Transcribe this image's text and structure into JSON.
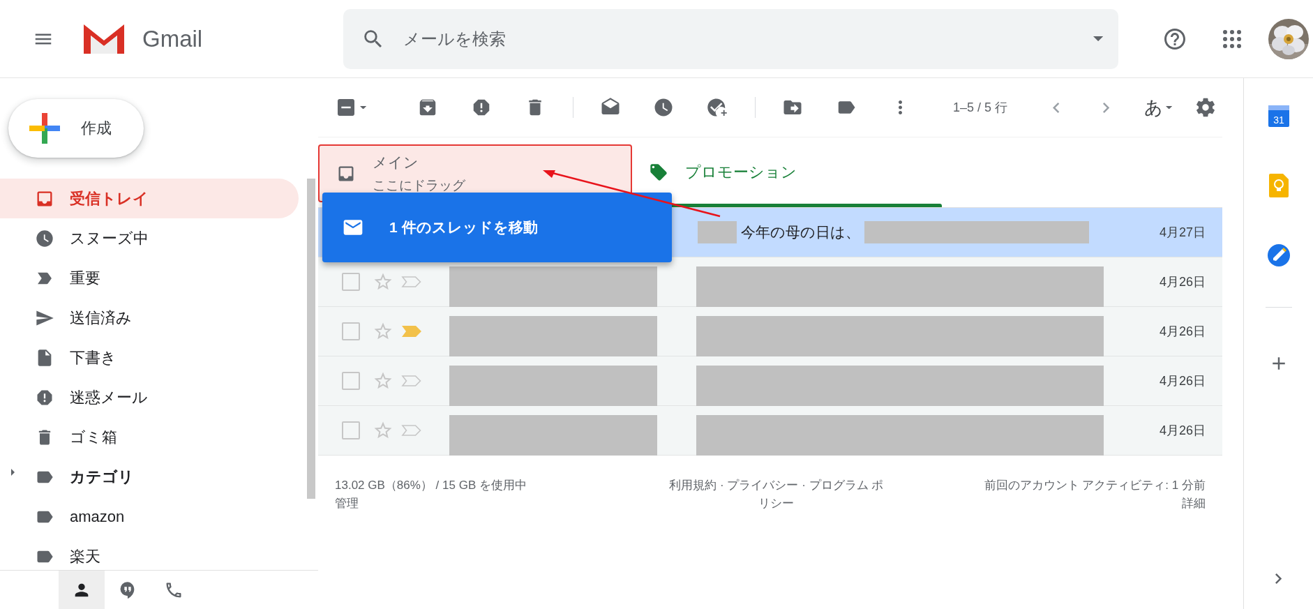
{
  "header": {
    "logo_text": "Gmail",
    "search": {
      "placeholder": "メールを検索"
    }
  },
  "compose": {
    "label": "作成"
  },
  "nav": [
    {
      "label": "受信トレイ",
      "kind": "inbox",
      "selected": true,
      "unread": false
    },
    {
      "label": "スヌーズ中",
      "kind": "snoozed",
      "selected": false,
      "unread": false
    },
    {
      "label": "重要",
      "kind": "important",
      "selected": false,
      "unread": false
    },
    {
      "label": "送信済み",
      "kind": "sent",
      "selected": false,
      "unread": false
    },
    {
      "label": "下書き",
      "kind": "drafts",
      "selected": false,
      "unread": false
    },
    {
      "label": "迷惑メール",
      "kind": "spam",
      "selected": false,
      "unread": false
    },
    {
      "label": "ゴミ箱",
      "kind": "trash",
      "selected": false,
      "unread": false
    },
    {
      "label": "カテゴリ",
      "kind": "label",
      "selected": false,
      "unread": true,
      "expanded": false
    },
    {
      "label": "amazon",
      "kind": "label",
      "selected": false,
      "unread": false
    },
    {
      "label": "楽天",
      "kind": "label",
      "selected": false,
      "unread": false
    }
  ],
  "bottom_tabs": [
    {
      "kind": "contacts",
      "selected": true
    },
    {
      "kind": "chat",
      "selected": false
    },
    {
      "kind": "phone",
      "selected": false
    }
  ],
  "toolbar": {
    "pager": "1–5 / 5 行",
    "input_tool": "あ"
  },
  "tabs": [
    {
      "label": "メイン",
      "subtitle": "ここにドラッグ",
      "kind": "primary",
      "selected": false,
      "drop_target": true
    },
    {
      "label": "プロモーション",
      "kind": "promotions",
      "selected": true,
      "drop_target": false
    }
  ],
  "rows": [
    {
      "selected": true,
      "subject": "今年の母の日は、",
      "date": "4月27日"
    },
    {
      "selected": false,
      "checked": false,
      "starred": false,
      "important": false,
      "date": "4月26日"
    },
    {
      "selected": false,
      "checked": false,
      "starred": false,
      "important": true,
      "date": "4月26日"
    },
    {
      "selected": false,
      "checked": false,
      "starred": false,
      "important": false,
      "date": "4月26日"
    },
    {
      "selected": false,
      "checked": false,
      "starred": false,
      "important": false,
      "date": "4月26日"
    }
  ],
  "drag_tooltip": {
    "label": "1 件のスレッドを移動"
  },
  "footer": {
    "storage": "13.02 GB（86%） / 15 GB を使用中",
    "manage": "管理",
    "policy": "利用規約 · プライバシー · プログラム ポリシー",
    "activity": "前回のアカウント アクティビティ: 1 分前",
    "details": "詳細"
  },
  "right_rail": {
    "calendar_day": "31"
  }
}
